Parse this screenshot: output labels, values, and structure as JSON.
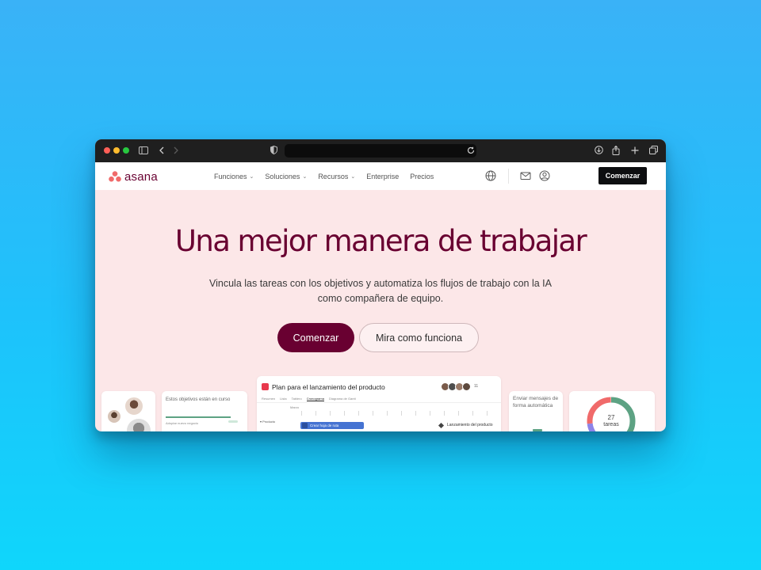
{
  "site": {
    "logo_text": "asana",
    "nav": {
      "items": [
        {
          "label": "Funciones",
          "has_dropdown": true
        },
        {
          "label": "Soluciones",
          "has_dropdown": true
        },
        {
          "label": "Recursos",
          "has_dropdown": true
        },
        {
          "label": "Enterprise",
          "has_dropdown": false
        },
        {
          "label": "Precios",
          "has_dropdown": false
        }
      ],
      "cta": "Comenzar"
    }
  },
  "hero": {
    "title": "Una mejor manera de trabajar",
    "subtitle": "Vincula las tareas con los objetivos y automatiza los flujos de trabajo con la IA como compañera de equipo.",
    "primary_button": "Comenzar",
    "secondary_button": "Mira como funciona"
  },
  "preview": {
    "goals_card": {
      "title": "Estos objetivos están en curso",
      "row_label": "Adoptar nuevo negocio"
    },
    "project_card": {
      "title": "Plan para el lanzamiento del producto",
      "member_count": "11",
      "tabs": [
        "Resumen",
        "Lista",
        "Tablero",
        "Cronograma",
        "Diagrama de Gantt"
      ],
      "active_tab": "Cronograma",
      "timeline_header": "Marzo",
      "row_group": "Producto",
      "task_label": "Crear hoja de ruta",
      "milestone": "Lanzamiento del producto"
    },
    "automation_card": {
      "text": "Enviar mensajes de forma automática"
    },
    "tasks_card": {
      "count": "27",
      "label": "tareas"
    }
  },
  "colors": {
    "brand": "#690031",
    "hero_bg": "#fce7e8",
    "logo_coral": "#f06a6a",
    "background_top": "#3ab2f7",
    "background_bottom": "#0fd6fb"
  }
}
